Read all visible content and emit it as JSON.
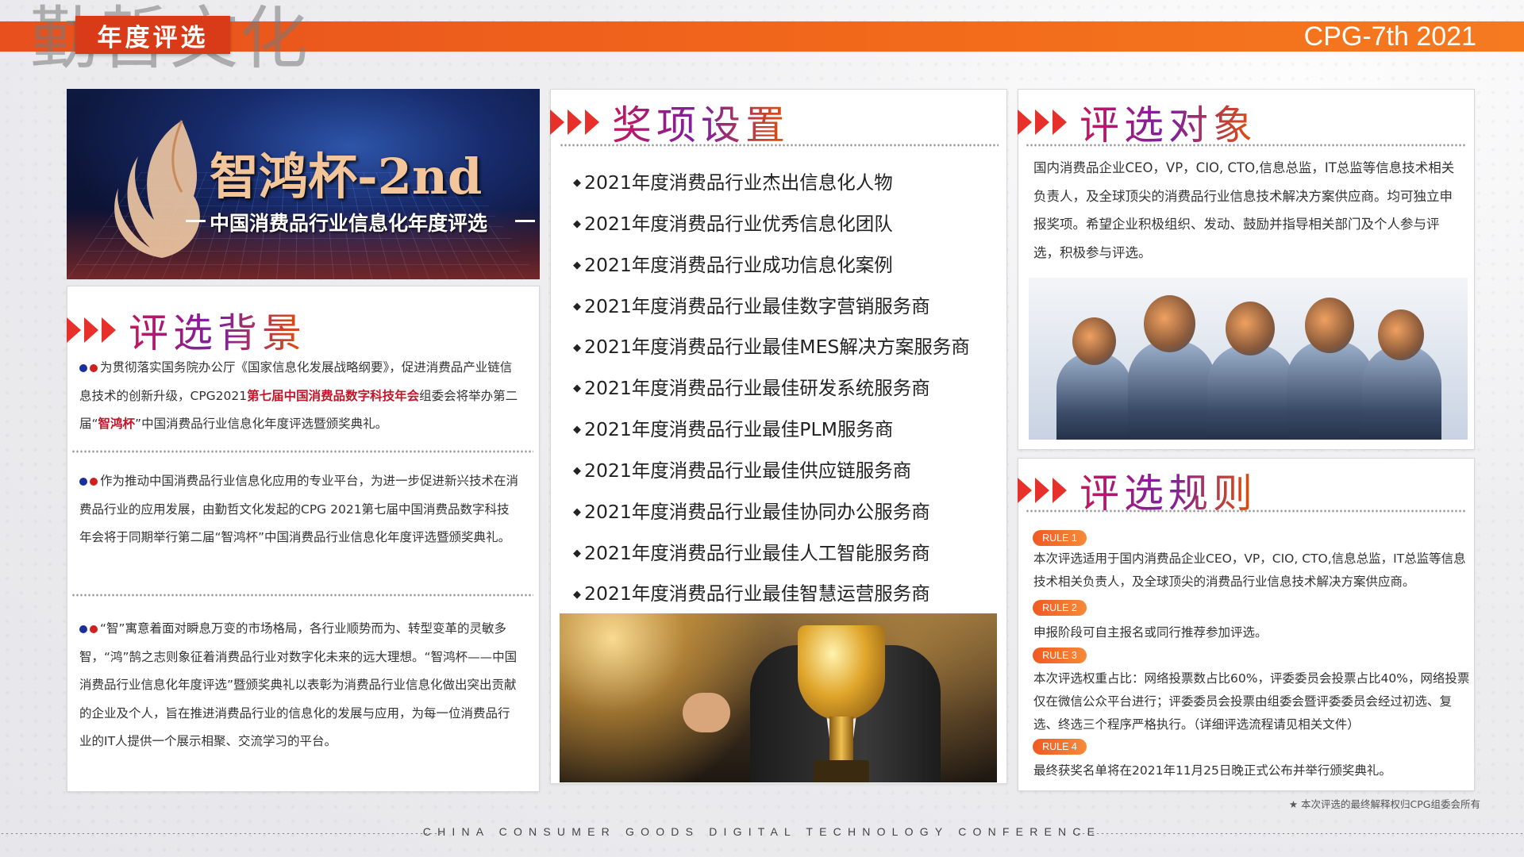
{
  "header": {
    "brand_watermark": "勤哲文化",
    "tag": "年度评选",
    "edition": "CPG-7th 2021"
  },
  "banner": {
    "title": "智鸿杯-2nd",
    "subtitle": "中国消费品行业信息化年度评选"
  },
  "background": {
    "title": "评选背景",
    "p1_pre": "为贯彻落实国务院办公厅《国家信息化发展战略纲要》，促进消费品产业链信息技术的创新升级，CPG2021",
    "p1_hl1": "第七届中国消费品数字科技年会",
    "p1_mid": "组委会将举办第二届“",
    "p1_hl2": "智鸿杯",
    "p1_post": "”中国消费品行业信息化年度评选暨颁奖典礼。",
    "p2": "作为推动中国消费品行业信息化应用的专业平台，为进一步促进新兴技术在消费品行业的应用发展，由勤哲文化发起的CPG 2021第七届中国消费品数字科技年会将于同期举行第二届“智鸿杯”中国消费品行业信息化年度评选暨颁奖典礼。",
    "p3": "“智”寓意着面对瞬息万变的市场格局，各行业顺势而为、转型变革的灵敏多智，“鸿”鹄之志则象征着消费品行业对数字化未来的远大理想。“智鸿杯——中国消费品行业信息化年度评选”暨颁奖典礼以表彰为消费品行业信息化做出突出贡献的企业及个人，旨在推进消费品行业的信息化的发展与应用，为每一位消费品行业的IT人提供一个展示相聚、交流学习的平台。"
  },
  "awards": {
    "title": "奖项设置",
    "items": [
      "2021年度消费品行业杰出信息化人物",
      "2021年度消费品行业优秀信息化团队",
      "2021年度消费品行业成功信息化案例",
      "2021年度消费品行业最佳数字营销服务商",
      "2021年度消费品行业最佳MES解决方案服务商",
      "2021年度消费品行业最佳研发系统服务商",
      "2021年度消费品行业最佳PLM服务商",
      "2021年度消费品行业最佳供应链服务商",
      "2021年度消费品行业最佳协同办公服务商",
      "2021年度消费品行业最佳人工智能服务商",
      "2021年度消费品行业最佳智慧运营服务商"
    ]
  },
  "objective": {
    "title": "评选对象",
    "text": "国内消费品企业CEO，VP，CIO, CTO,信息总监，IT总监等信息技术相关负责人，及全球顶尖的消费品行业信息技术解决方案供应商。均可独立申报奖项。希望企业积极组织、发动、鼓励并指导相关部门及个人参与评选，积极参与评选。"
  },
  "rules": {
    "title": "评选规则",
    "items": [
      {
        "tag": "RULE 1",
        "text": "本次评选适用于国内消费品企业CEO，VP，CIO, CTO,信息总监，IT总监等信息技术相关负责人，及全球顶尖的消费品行业信息技术解决方案供应商。"
      },
      {
        "tag": "RULE 2",
        "text": "申报阶段可自主报名或同行推荐参加评选。"
      },
      {
        "tag": "RULE 3",
        "text": "本次评选权重占比：网络投票数占比60%，评委委员会投票占比40%，网络投票仅在微信公众平台进行；评委委员会投票由组委会暨评委委员会经过初选、复选、终选三个程序严格执行。（详细评选流程请见相关文件）"
      },
      {
        "tag": "RULE 4",
        "text": "最终获奖名单将在2021年11月25日晚正式公布并举行颁奖典礼。"
      }
    ]
  },
  "footnote": "★ 本次评选的最终解释权归CPG组委会所有",
  "footer": "CHINA CONSUMER GOODS DIGITAL TECHNOLOGY CONFERENCE",
  "colors": {
    "accent": "#f26a1b",
    "highlight": "#c0182a",
    "arrow": "#e8302b"
  }
}
